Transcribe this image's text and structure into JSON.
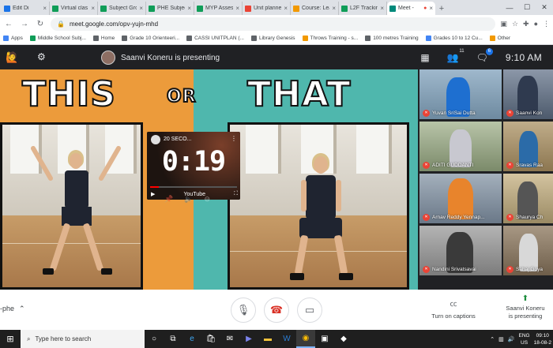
{
  "browser": {
    "tabs": [
      {
        "label": "Edit Di",
        "color": "#1a73e8"
      },
      {
        "label": "Virtual clas",
        "color": "#0f9d58"
      },
      {
        "label": "Subject Gro",
        "color": "#0f9d58"
      },
      {
        "label": "PHE Subjec",
        "color": "#0f9d58"
      },
      {
        "label": "MYP Asses",
        "color": "#0f9d58"
      },
      {
        "label": "Unit planne",
        "color": "#ea4335"
      },
      {
        "label": "Course: Lea",
        "color": "#f29900"
      },
      {
        "label": "L2F Trackin",
        "color": "#0f9d58"
      },
      {
        "label": "Meet -",
        "color": "#00897b"
      }
    ],
    "new_tab": "+",
    "url": "meet.google.com/opv-yujn-mhd",
    "bookmarks": [
      {
        "label": "Apps",
        "color": "#4285f4"
      },
      {
        "label": "Middle School Subj...",
        "color": "#0f9d58"
      },
      {
        "label": "Home",
        "color": "#5f6368"
      },
      {
        "label": "Grade 10 Orienteeri...",
        "color": "#5f6368"
      },
      {
        "label": "CASSI UNITPLAN (...",
        "color": "#5f6368"
      },
      {
        "label": "Library Genesis",
        "color": "#5f6368"
      },
      {
        "label": "Throws Training - s...",
        "color": "#f29900"
      },
      {
        "label": "100 metres Training",
        "color": "#5f6368"
      },
      {
        "label": "Grades 10 to 12 Cu...",
        "color": "#4285f4"
      },
      {
        "label": "Other",
        "color": "#f29900"
      }
    ]
  },
  "meet": {
    "presenting_text": "Saanvi Koneru is presenting",
    "participants_count": "11",
    "chat_badge": "6",
    "clock": "9:10 AM",
    "meeting_code": "-phe",
    "turn_on_captions": "Turn on captions",
    "presenting_label": "Saanvi Koneru\nis presenting"
  },
  "slide": {
    "left_word": "THIS",
    "middle_word": "OR",
    "right_word": "THAT",
    "left_color": "#ec9b3b",
    "right_color": "#4fb7ad"
  },
  "youtube": {
    "title": "20 SECO...",
    "timer": "0:19",
    "logo": "YouTube"
  },
  "participants": [
    {
      "name": "Yuvan SriSai Dutta",
      "bg": "#4b6f8a"
    },
    {
      "name": "Saanvi Kon",
      "bg": "#5a6a7a"
    },
    {
      "name": "ADITI GUDDANTI",
      "bg": "#7a8a6a"
    },
    {
      "name": "Sravas Raa",
      "bg": "#8a7a5a"
    },
    {
      "name": "Arnav Reddy Yennap...",
      "bg": "#6a7a8a"
    },
    {
      "name": "Shaurya Ch",
      "bg": "#9a8a6a"
    },
    {
      "name": "Nandini Srivatsavai",
      "bg": "#8a8a8a"
    },
    {
      "name": "Sahaj Goya",
      "bg": "#7a6a5a"
    }
  ],
  "taskbar": {
    "search_placeholder": "Type here to search",
    "lang": "ENG",
    "region": "US",
    "time": "09:10",
    "date": "18-08-2"
  }
}
